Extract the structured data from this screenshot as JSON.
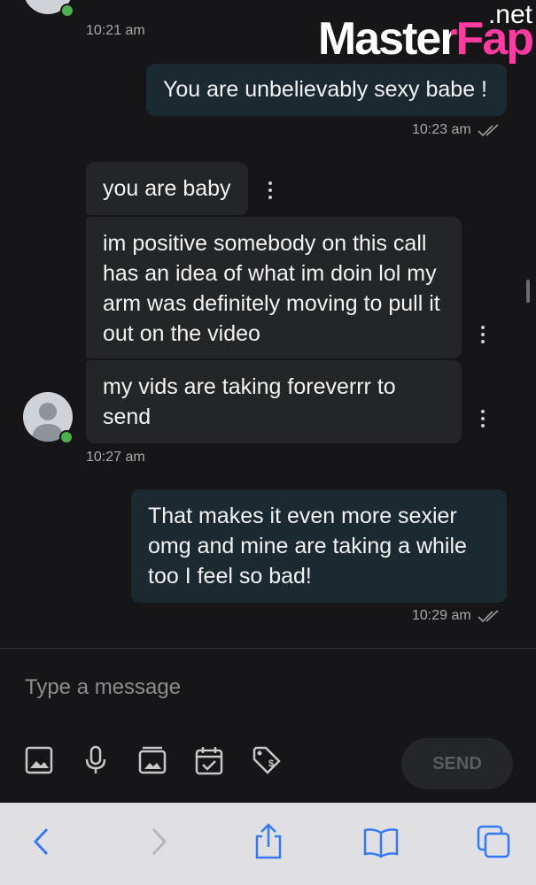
{
  "watermark": {
    "text": "MasterFap",
    "suffix": ".net"
  },
  "messages": [
    {
      "type": "timestamp",
      "side": "in",
      "time": "10:21 am"
    },
    {
      "type": "out",
      "text": "You are unbelievably sexy babe !",
      "time": "10:23 am"
    },
    {
      "type": "in",
      "text": "you are baby"
    },
    {
      "type": "in",
      "text": "im positive somebody on this call has an idea of what im doin lol my arm was definitely moving to pull it out on the video"
    },
    {
      "type": "in",
      "text": "my vids are taking foreverrr to send",
      "time": "10:27 am"
    },
    {
      "type": "out",
      "text": "That makes it even more sexier omg and mine are taking a while too I feel so bad!",
      "time": "10:29 am"
    }
  ],
  "composer": {
    "placeholder": "Type a message",
    "send_label": "SEND",
    "tools": [
      "image-icon",
      "microphone-icon",
      "gallery-icon",
      "calendar-check-icon",
      "price-tag-icon"
    ]
  },
  "browser_bar": {
    "icons": [
      "back-icon",
      "forward-icon",
      "share-icon",
      "bookmarks-icon",
      "tabs-icon"
    ]
  },
  "colors": {
    "background": "#161618",
    "incoming_bubble": "#232527",
    "outgoing_bubble": "#1b2a30",
    "online_dot": "#4caf50",
    "browser_blue": "#3478f6"
  }
}
